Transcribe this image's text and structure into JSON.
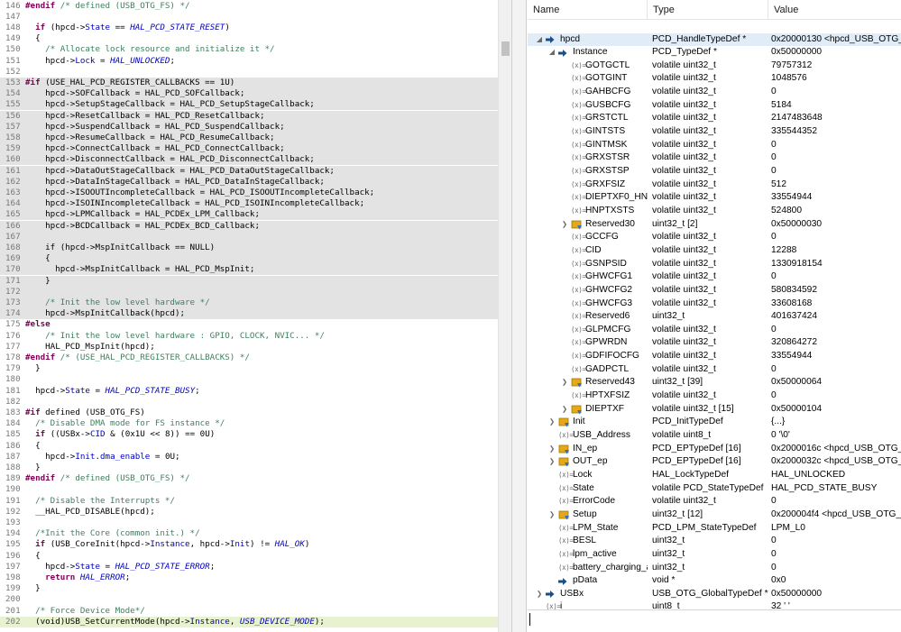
{
  "editor": {
    "lines": [
      {
        "n": "146",
        "t": [
          [
            "kw",
            "#endif"
          ],
          [
            "cm",
            " /* defined (USB_OTG_FS) */"
          ]
        ]
      },
      {
        "n": "147",
        "t": []
      },
      {
        "n": "148",
        "t": [
          [
            "pl",
            "  "
          ],
          [
            "kw",
            "if"
          ],
          [
            "pl",
            " (hpcd->"
          ],
          [
            "mb",
            "State"
          ],
          [
            "pl",
            " == "
          ],
          [
            "it",
            "HAL_PCD_STATE_RESET"
          ],
          [
            "pl",
            ")"
          ]
        ]
      },
      {
        "n": "149",
        "t": [
          [
            "pl",
            "  {"
          ]
        ]
      },
      {
        "n": "150",
        "t": [
          [
            "cm",
            "    /* Allocate lock resource and initialize it */"
          ]
        ]
      },
      {
        "n": "151",
        "t": [
          [
            "pl",
            "    hpcd->"
          ],
          [
            "mb",
            "Lock"
          ],
          [
            "pl",
            " = "
          ],
          [
            "it",
            "HAL_UNLOCKED"
          ],
          [
            "pl",
            ";"
          ]
        ]
      },
      {
        "n": "152",
        "t": []
      },
      {
        "n": "153",
        "t": [
          [
            "kw",
            "#if"
          ],
          [
            "pl",
            " (USE_HAL_PCD_REGISTER_CALLBACKS == 1U)"
          ]
        ],
        "inactive": true
      },
      {
        "n": "154",
        "t": [
          [
            "pl",
            "    hpcd->SOFCallback = HAL_PCD_SOFCallback;"
          ]
        ],
        "inactive": true
      },
      {
        "n": "155",
        "t": [
          [
            "pl",
            "    hpcd->SetupStageCallback = HAL_PCD_SetupStageCallback;"
          ]
        ],
        "inactive": true
      },
      {
        "n": "156",
        "t": [
          [
            "pl",
            "    hpcd->ResetCallback = HAL_PCD_ResetCallback;"
          ]
        ],
        "inactive": true
      },
      {
        "n": "157",
        "t": [
          [
            "pl",
            "    hpcd->SuspendCallback = HAL_PCD_SuspendCallback;"
          ]
        ],
        "inactive": true
      },
      {
        "n": "158",
        "t": [
          [
            "pl",
            "    hpcd->ResumeCallback = HAL_PCD_ResumeCallback;"
          ]
        ],
        "inactive": true
      },
      {
        "n": "159",
        "t": [
          [
            "pl",
            "    hpcd->ConnectCallback = HAL_PCD_ConnectCallback;"
          ]
        ],
        "inactive": true
      },
      {
        "n": "160",
        "t": [
          [
            "pl",
            "    hpcd->DisconnectCallback = HAL_PCD_DisconnectCallback;"
          ]
        ],
        "inactive": true
      },
      {
        "n": "161",
        "t": [
          [
            "pl",
            "    hpcd->DataOutStageCallback = HAL_PCD_DataOutStageCallback;"
          ]
        ],
        "inactive": true
      },
      {
        "n": "162",
        "t": [
          [
            "pl",
            "    hpcd->DataInStageCallback = HAL_PCD_DataInStageCallback;"
          ]
        ],
        "inactive": true
      },
      {
        "n": "163",
        "t": [
          [
            "pl",
            "    hpcd->ISOOUTIncompleteCallback = HAL_PCD_ISOOUTIncompleteCallback;"
          ]
        ],
        "inactive": true
      },
      {
        "n": "164",
        "t": [
          [
            "pl",
            "    hpcd->ISOINIncompleteCallback = HAL_PCD_ISOINIncompleteCallback;"
          ]
        ],
        "inactive": true
      },
      {
        "n": "165",
        "t": [
          [
            "pl",
            "    hpcd->LPMCallback = HAL_PCDEx_LPM_Callback;"
          ]
        ],
        "inactive": true
      },
      {
        "n": "166",
        "t": [
          [
            "pl",
            "    hpcd->BCDCallback = HAL_PCDEx_BCD_Callback;"
          ]
        ],
        "inactive": true
      },
      {
        "n": "167",
        "t": [],
        "inactive": true
      },
      {
        "n": "168",
        "t": [
          [
            "pl",
            "    if (hpcd->MspInitCallback == NULL)"
          ]
        ],
        "inactive": true
      },
      {
        "n": "169",
        "t": [
          [
            "pl",
            "    {"
          ]
        ],
        "inactive": true
      },
      {
        "n": "170",
        "t": [
          [
            "pl",
            "      hpcd->MspInitCallback = HAL_PCD_MspInit;"
          ]
        ],
        "inactive": true
      },
      {
        "n": "171",
        "t": [
          [
            "pl",
            "    }"
          ]
        ],
        "inactive": true
      },
      {
        "n": "172",
        "t": [],
        "inactive": true
      },
      {
        "n": "173",
        "t": [
          [
            "cm",
            "    /* Init the low level hardware */"
          ]
        ],
        "inactive": true
      },
      {
        "n": "174",
        "t": [
          [
            "pl",
            "    hpcd->MspInitCallback(hpcd);"
          ]
        ],
        "inactive": true
      },
      {
        "n": "175",
        "t": [
          [
            "kw",
            "#else"
          ]
        ]
      },
      {
        "n": "176",
        "t": [
          [
            "cm",
            "    /* Init the low level hardware : GPIO, CLOCK, NVIC... */"
          ]
        ]
      },
      {
        "n": "177",
        "t": [
          [
            "pl",
            "    HAL_PCD_MspInit(hpcd);"
          ]
        ]
      },
      {
        "n": "178",
        "t": [
          [
            "kw",
            "#endif"
          ],
          [
            "cm",
            " /* (USE_HAL_PCD_REGISTER_CALLBACKS) */"
          ]
        ]
      },
      {
        "n": "179",
        "t": [
          [
            "pl",
            "  }"
          ]
        ]
      },
      {
        "n": "180",
        "t": []
      },
      {
        "n": "181",
        "t": [
          [
            "pl",
            "  hpcd->"
          ],
          [
            "mb",
            "State"
          ],
          [
            "pl",
            " = "
          ],
          [
            "it",
            "HAL_PCD_STATE_BUSY"
          ],
          [
            "pl",
            ";"
          ]
        ]
      },
      {
        "n": "182",
        "t": []
      },
      {
        "n": "183",
        "t": [
          [
            "kw",
            "#if"
          ],
          [
            "pl",
            " defined (USB_OTG_FS)"
          ]
        ]
      },
      {
        "n": "184",
        "t": [
          [
            "cm",
            "  /* Disable DMA mode for FS instance */"
          ]
        ]
      },
      {
        "n": "185",
        "t": [
          [
            "pl",
            "  "
          ],
          [
            "kw",
            "if"
          ],
          [
            "pl",
            " ((USBx->"
          ],
          [
            "mb",
            "CID"
          ],
          [
            "pl",
            " & (0x1U << 8)) == 0U)"
          ]
        ]
      },
      {
        "n": "186",
        "t": [
          [
            "pl",
            "  {"
          ]
        ]
      },
      {
        "n": "187",
        "t": [
          [
            "pl",
            "    hpcd->"
          ],
          [
            "mb",
            "Init"
          ],
          [
            "pl",
            "."
          ],
          [
            "mb",
            "dma_enable"
          ],
          [
            "pl",
            " = 0U;"
          ]
        ]
      },
      {
        "n": "188",
        "t": [
          [
            "pl",
            "  }"
          ]
        ]
      },
      {
        "n": "189",
        "t": [
          [
            "kw",
            "#endif"
          ],
          [
            "cm",
            " /* defined (USB_OTG_FS) */"
          ]
        ]
      },
      {
        "n": "190",
        "t": []
      },
      {
        "n": "191",
        "t": [
          [
            "cm",
            "  /* Disable the Interrupts */"
          ]
        ]
      },
      {
        "n": "192",
        "t": [
          [
            "pl",
            "  __HAL_PCD_DISABLE(hpcd);"
          ]
        ]
      },
      {
        "n": "193",
        "t": []
      },
      {
        "n": "194",
        "t": [
          [
            "cm",
            "  /*Init the Core (common init.) */"
          ]
        ]
      },
      {
        "n": "195",
        "t": [
          [
            "pl",
            "  "
          ],
          [
            "kw",
            "if"
          ],
          [
            "pl",
            " (USB_CoreInit(hpcd->"
          ],
          [
            "mb",
            "Instance"
          ],
          [
            "pl",
            ", hpcd->"
          ],
          [
            "mb",
            "Init"
          ],
          [
            "pl",
            ") != "
          ],
          [
            "it",
            "HAL_OK"
          ],
          [
            "pl",
            ")"
          ]
        ]
      },
      {
        "n": "196",
        "t": [
          [
            "pl",
            "  {"
          ]
        ]
      },
      {
        "n": "197",
        "t": [
          [
            "pl",
            "    hpcd->"
          ],
          [
            "mb",
            "State"
          ],
          [
            "pl",
            " = "
          ],
          [
            "it",
            "HAL_PCD_STATE_ERROR"
          ],
          [
            "pl",
            ";"
          ]
        ]
      },
      {
        "n": "198",
        "t": [
          [
            "pl",
            "    "
          ],
          [
            "kw",
            "return"
          ],
          [
            "pl",
            " "
          ],
          [
            "it",
            "HAL_ERROR"
          ],
          [
            "pl",
            ";"
          ]
        ]
      },
      {
        "n": "199",
        "t": [
          [
            "pl",
            "  }"
          ]
        ]
      },
      {
        "n": "200",
        "t": []
      },
      {
        "n": "201",
        "t": [
          [
            "cm",
            "  /* Force Device Mode*/"
          ]
        ]
      },
      {
        "n": "202",
        "t": [
          [
            "pl",
            "  (void)USB_SetCurrentMode(hpcd->"
          ],
          [
            "mb",
            "Instance"
          ],
          [
            "pl",
            ", "
          ],
          [
            "it",
            "USB_DEVICE_MODE"
          ],
          [
            "pl",
            ");"
          ]
        ],
        "cursor": true
      }
    ]
  },
  "variables": {
    "columns": {
      "name": "Name",
      "type": "Type",
      "value": "Value"
    },
    "rows": [
      {
        "name": "hpcd",
        "type": "PCD_HandleTypeDef *",
        "value": "0x20000130 <hpcd_USB_OTG_FS>",
        "icon": "arrow",
        "toggle": "expanded",
        "level": 0,
        "selected": true
      },
      {
        "name": "Instance",
        "type": "PCD_TypeDef *",
        "value": "0x50000000",
        "icon": "arrow",
        "toggle": "expanded",
        "level": 1
      },
      {
        "name": "GOTGCTL",
        "type": "volatile uint32_t",
        "value": "79757312",
        "icon": "field",
        "toggle": "",
        "level": 2
      },
      {
        "name": "GOTGINT",
        "type": "volatile uint32_t",
        "value": "1048576",
        "icon": "field",
        "toggle": "",
        "level": 2
      },
      {
        "name": "GAHBCFG",
        "type": "volatile uint32_t",
        "value": "0",
        "icon": "field",
        "toggle": "",
        "level": 2
      },
      {
        "name": "GUSBCFG",
        "type": "volatile uint32_t",
        "value": "5184",
        "icon": "field",
        "toggle": "",
        "level": 2
      },
      {
        "name": "GRSTCTL",
        "type": "volatile uint32_t",
        "value": "2147483648",
        "icon": "field",
        "toggle": "",
        "level": 2
      },
      {
        "name": "GINTSTS",
        "type": "volatile uint32_t",
        "value": "335544352",
        "icon": "field",
        "toggle": "",
        "level": 2
      },
      {
        "name": "GINTMSK",
        "type": "volatile uint32_t",
        "value": "0",
        "icon": "field",
        "toggle": "",
        "level": 2
      },
      {
        "name": "GRXSTSR",
        "type": "volatile uint32_t",
        "value": "0",
        "icon": "field",
        "toggle": "",
        "level": 2
      },
      {
        "name": "GRXSTSP",
        "type": "volatile uint32_t",
        "value": "0",
        "icon": "field",
        "toggle": "",
        "level": 2
      },
      {
        "name": "GRXFSIZ",
        "type": "volatile uint32_t",
        "value": "512",
        "icon": "field",
        "toggle": "",
        "level": 2
      },
      {
        "name": "DIEPTXF0_HNPTXFSIZ",
        "type": "volatile uint32_t",
        "value": "33554944",
        "icon": "field",
        "toggle": "",
        "level": 2
      },
      {
        "name": "HNPTXSTS",
        "type": "volatile uint32_t",
        "value": "524800",
        "icon": "field",
        "toggle": "",
        "level": 2
      },
      {
        "name": "Reserved30",
        "type": "uint32_t [2]",
        "value": "0x50000030",
        "icon": "struct",
        "toggle": "collapsed",
        "level": 2
      },
      {
        "name": "GCCFG",
        "type": "volatile uint32_t",
        "value": "0",
        "icon": "field",
        "toggle": "",
        "level": 2
      },
      {
        "name": "CID",
        "type": "volatile uint32_t",
        "value": "12288",
        "icon": "field",
        "toggle": "",
        "level": 2
      },
      {
        "name": "GSNPSID",
        "type": "volatile uint32_t",
        "value": "1330918154",
        "icon": "field",
        "toggle": "",
        "level": 2
      },
      {
        "name": "GHWCFG1",
        "type": "volatile uint32_t",
        "value": "0",
        "icon": "field",
        "toggle": "",
        "level": 2
      },
      {
        "name": "GHWCFG2",
        "type": "volatile uint32_t",
        "value": "580834592",
        "icon": "field",
        "toggle": "",
        "level": 2
      },
      {
        "name": "GHWCFG3",
        "type": "volatile uint32_t",
        "value": "33608168",
        "icon": "field",
        "toggle": "",
        "level": 2
      },
      {
        "name": "Reserved6",
        "type": "uint32_t",
        "value": "401637424",
        "icon": "field",
        "toggle": "",
        "level": 2
      },
      {
        "name": "GLPMCFG",
        "type": "volatile uint32_t",
        "value": "0",
        "icon": "field",
        "toggle": "",
        "level": 2
      },
      {
        "name": "GPWRDN",
        "type": "volatile uint32_t",
        "value": "320864272",
        "icon": "field",
        "toggle": "",
        "level": 2
      },
      {
        "name": "GDFIFOCFG",
        "type": "volatile uint32_t",
        "value": "33554944",
        "icon": "field",
        "toggle": "",
        "level": 2
      },
      {
        "name": "GADPCTL",
        "type": "volatile uint32_t",
        "value": "0",
        "icon": "field",
        "toggle": "",
        "level": 2
      },
      {
        "name": "Reserved43",
        "type": "uint32_t [39]",
        "value": "0x50000064",
        "icon": "struct",
        "toggle": "collapsed",
        "level": 2
      },
      {
        "name": "HPTXFSIZ",
        "type": "volatile uint32_t",
        "value": "0",
        "icon": "field",
        "toggle": "",
        "level": 2
      },
      {
        "name": "DIEPTXF",
        "type": "volatile uint32_t [15]",
        "value": "0x50000104",
        "icon": "struct",
        "toggle": "collapsed",
        "level": 2
      },
      {
        "name": "Init",
        "type": "PCD_InitTypeDef",
        "value": "{...}",
        "icon": "struct",
        "toggle": "collapsed",
        "level": 1
      },
      {
        "name": "USB_Address",
        "type": "volatile uint8_t",
        "value": "0 '\\0'",
        "icon": "field",
        "toggle": "",
        "level": 1
      },
      {
        "name": "IN_ep",
        "type": "PCD_EPTypeDef [16]",
        "value": "0x2000016c <hpcd_USB_OTG_FS+60>",
        "icon": "struct",
        "toggle": "collapsed",
        "level": 1
      },
      {
        "name": "OUT_ep",
        "type": "PCD_EPTypeDef [16]",
        "value": "0x2000032c <hpcd_USB_OTG_FS+508>",
        "icon": "struct",
        "toggle": "collapsed",
        "level": 1
      },
      {
        "name": "Lock",
        "type": "HAL_LockTypeDef",
        "value": "HAL_UNLOCKED",
        "icon": "field",
        "toggle": "",
        "level": 1
      },
      {
        "name": "State",
        "type": "volatile PCD_StateTypeDef",
        "value": "HAL_PCD_STATE_BUSY",
        "icon": "field",
        "toggle": "",
        "level": 1
      },
      {
        "name": "ErrorCode",
        "type": "volatile uint32_t",
        "value": "0",
        "icon": "field",
        "toggle": "",
        "level": 1
      },
      {
        "name": "Setup",
        "type": "uint32_t [12]",
        "value": "0x200004f4 <hpcd_USB_OTG_FS+964>",
        "icon": "struct",
        "toggle": "collapsed",
        "level": 1
      },
      {
        "name": "LPM_State",
        "type": "PCD_LPM_StateTypeDef",
        "value": "LPM_L0",
        "icon": "field",
        "toggle": "",
        "level": 1
      },
      {
        "name": "BESL",
        "type": "uint32_t",
        "value": "0",
        "icon": "field",
        "toggle": "",
        "level": 1
      },
      {
        "name": "lpm_active",
        "type": "uint32_t",
        "value": "0",
        "icon": "field",
        "toggle": "",
        "level": 1
      },
      {
        "name": "battery_charging_active",
        "type": "uint32_t",
        "value": "0",
        "icon": "field",
        "toggle": "",
        "level": 1
      },
      {
        "name": "pData",
        "type": "void *",
        "value": "0x0",
        "icon": "arrow",
        "toggle": "",
        "level": 1
      },
      {
        "name": "USBx",
        "type": "USB_OTG_GlobalTypeDef *",
        "value": "0x50000000",
        "icon": "arrow",
        "toggle": "collapsed",
        "level": 0
      },
      {
        "name": "i",
        "type": "uint8_t",
        "value": "32 ' '",
        "icon": "field",
        "toggle": "",
        "level": 0
      }
    ]
  },
  "colors": {
    "keyword": "#7f0055",
    "comment": "#3f7f5f",
    "member": "#0000c0",
    "inactive_block": "#e3e3e3",
    "current_line": "#e8f2d0",
    "pointer_icon": "#1b4c8c",
    "struct_icon": "#e4a818"
  }
}
